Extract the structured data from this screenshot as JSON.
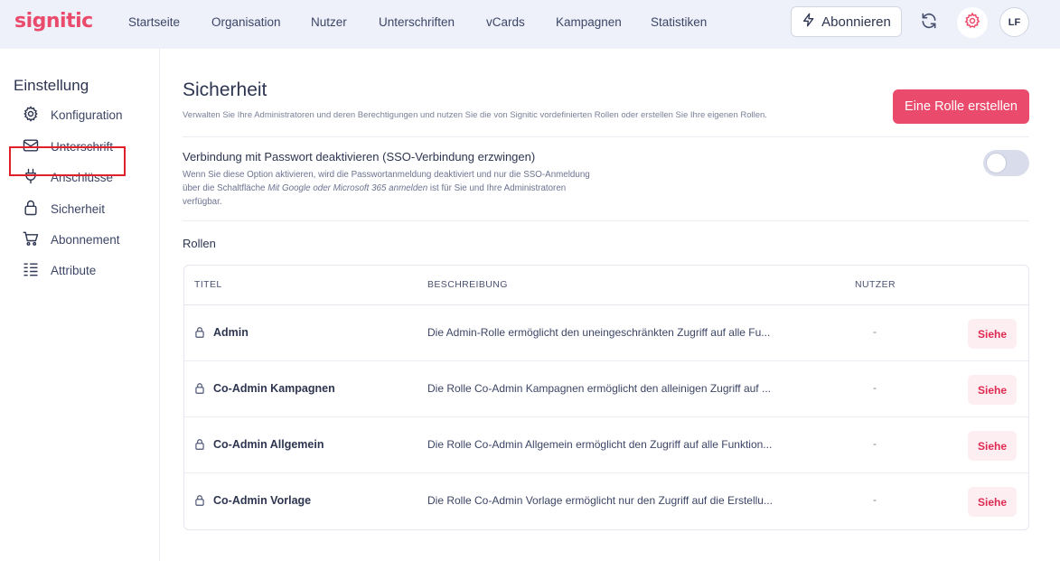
{
  "brand": {
    "logo_text": "signitic",
    "accent": "#ea4a6b"
  },
  "nav": {
    "items": [
      "Startseite",
      "Organisation",
      "Nutzer",
      "Unterschriften",
      "vCards",
      "Kampagnen",
      "Statistiken"
    ],
    "subscribe_label": "Abonnieren",
    "avatar_initials": "LF",
    "icons": [
      "bolt-icon",
      "refresh-icon",
      "gear-icon"
    ]
  },
  "sidebar": {
    "title": "Einstellung",
    "items": [
      {
        "label": "Konfiguration",
        "icon": "gear-icon"
      },
      {
        "label": "Unterschrift",
        "icon": "envelope-icon"
      },
      {
        "label": "Anschlüsse",
        "icon": "plug-icon"
      },
      {
        "label": "Sicherheit",
        "icon": "lock-icon",
        "active": true
      },
      {
        "label": "Abonnement",
        "icon": "cart-icon"
      },
      {
        "label": "Attribute",
        "icon": "list-icon"
      }
    ]
  },
  "main": {
    "title": "Sicherheit",
    "subtitle": "Verwalten Sie Ihre Administratoren und deren Berechtigungen und nutzen Sie die von Signitic vordefinierten Rollen oder erstellen Sie Ihre eigenen Rollen.",
    "create_button": "Eine Rolle erstellen",
    "sso": {
      "title": "Verbindung mit Passwort deaktivieren (SSO-Verbindung erzwingen)",
      "desc_before": "Wenn Sie diese Option aktivieren, wird die Passwortanmeldung deaktiviert und nur die SSO-Anmeldung über die Schaltfläche ",
      "desc_italic": "Mit Google oder Microsoft 365 anmelden",
      "desc_after": " ist für Sie und Ihre Administratoren verfügbar.",
      "enabled": false
    },
    "roles_heading": "Rollen",
    "table": {
      "headers": {
        "title": "TITEL",
        "description": "BESCHREIBUNG",
        "users": "NUTZER"
      },
      "rows": [
        {
          "name": "Admin",
          "description": "Die Admin-Rolle ermöglicht den uneingeschränkten Zugriff auf alle Fu...",
          "users": "-",
          "action": "Siehe"
        },
        {
          "name": "Co-Admin Kampagnen",
          "description": "Die Rolle Co-Admin Kampagnen ermöglicht den alleinigen Zugriff auf ...",
          "users": "-",
          "action": "Siehe"
        },
        {
          "name": "Co-Admin Allgemein",
          "description": "Die Rolle Co-Admin Allgemein ermöglicht den Zugriff auf alle Funktion...",
          "users": "-",
          "action": "Siehe"
        },
        {
          "name": "Co-Admin Vorlage",
          "description": "Die Rolle Co-Admin Vorlage ermöglicht nur den Zugriff auf die Erstellu...",
          "users": "-",
          "action": "Siehe"
        }
      ]
    }
  }
}
